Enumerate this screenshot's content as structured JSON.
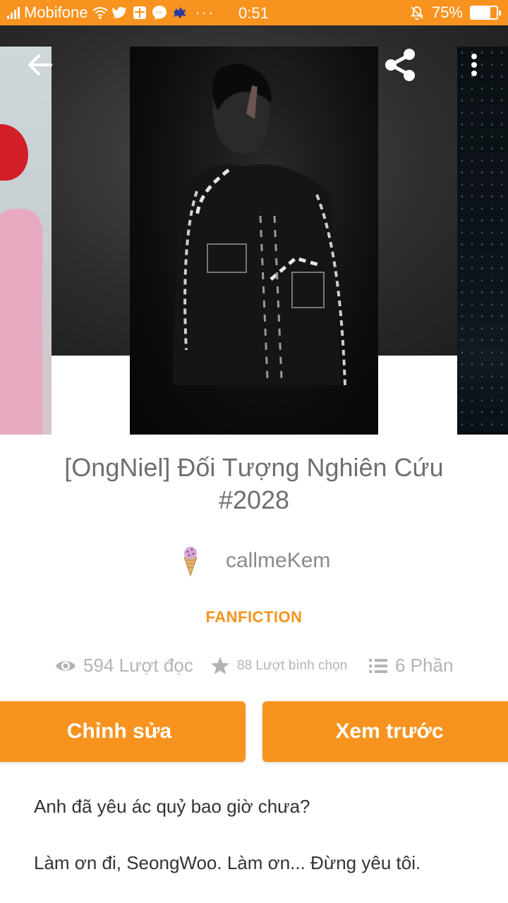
{
  "status_bar": {
    "carrier": "Mobifone",
    "time": "0:51",
    "battery_percent": "75%",
    "battery_level": 0.75,
    "dots": "···"
  },
  "story": {
    "title": "[OngNiel] Đối Tượng Nghiên Cứu #2028",
    "author": "callmeKem",
    "category": "FANFICTION",
    "reads": "594 Lượt đọc",
    "votes": "88 Lượt bình chọn",
    "parts": "6 Phần"
  },
  "actions": {
    "edit_label": "Chỉnh sửa",
    "preview_label": "Xem trước"
  },
  "description": {
    "line1": "Anh đã yêu ác quỷ bao giờ chưa?",
    "line2": "Làm ơn đi, SeongWoo. Làm ơn... Đừng yêu tôi."
  },
  "icons": {
    "back": "arrow-left-icon",
    "share": "share-icon",
    "more": "more-vertical-icon",
    "reads": "eye-icon",
    "votes": "star-icon",
    "parts": "list-icon"
  },
  "colors": {
    "accent": "#f7931e",
    "title_text": "#6f6f6f",
    "stat_text": "#b4b4b4"
  }
}
